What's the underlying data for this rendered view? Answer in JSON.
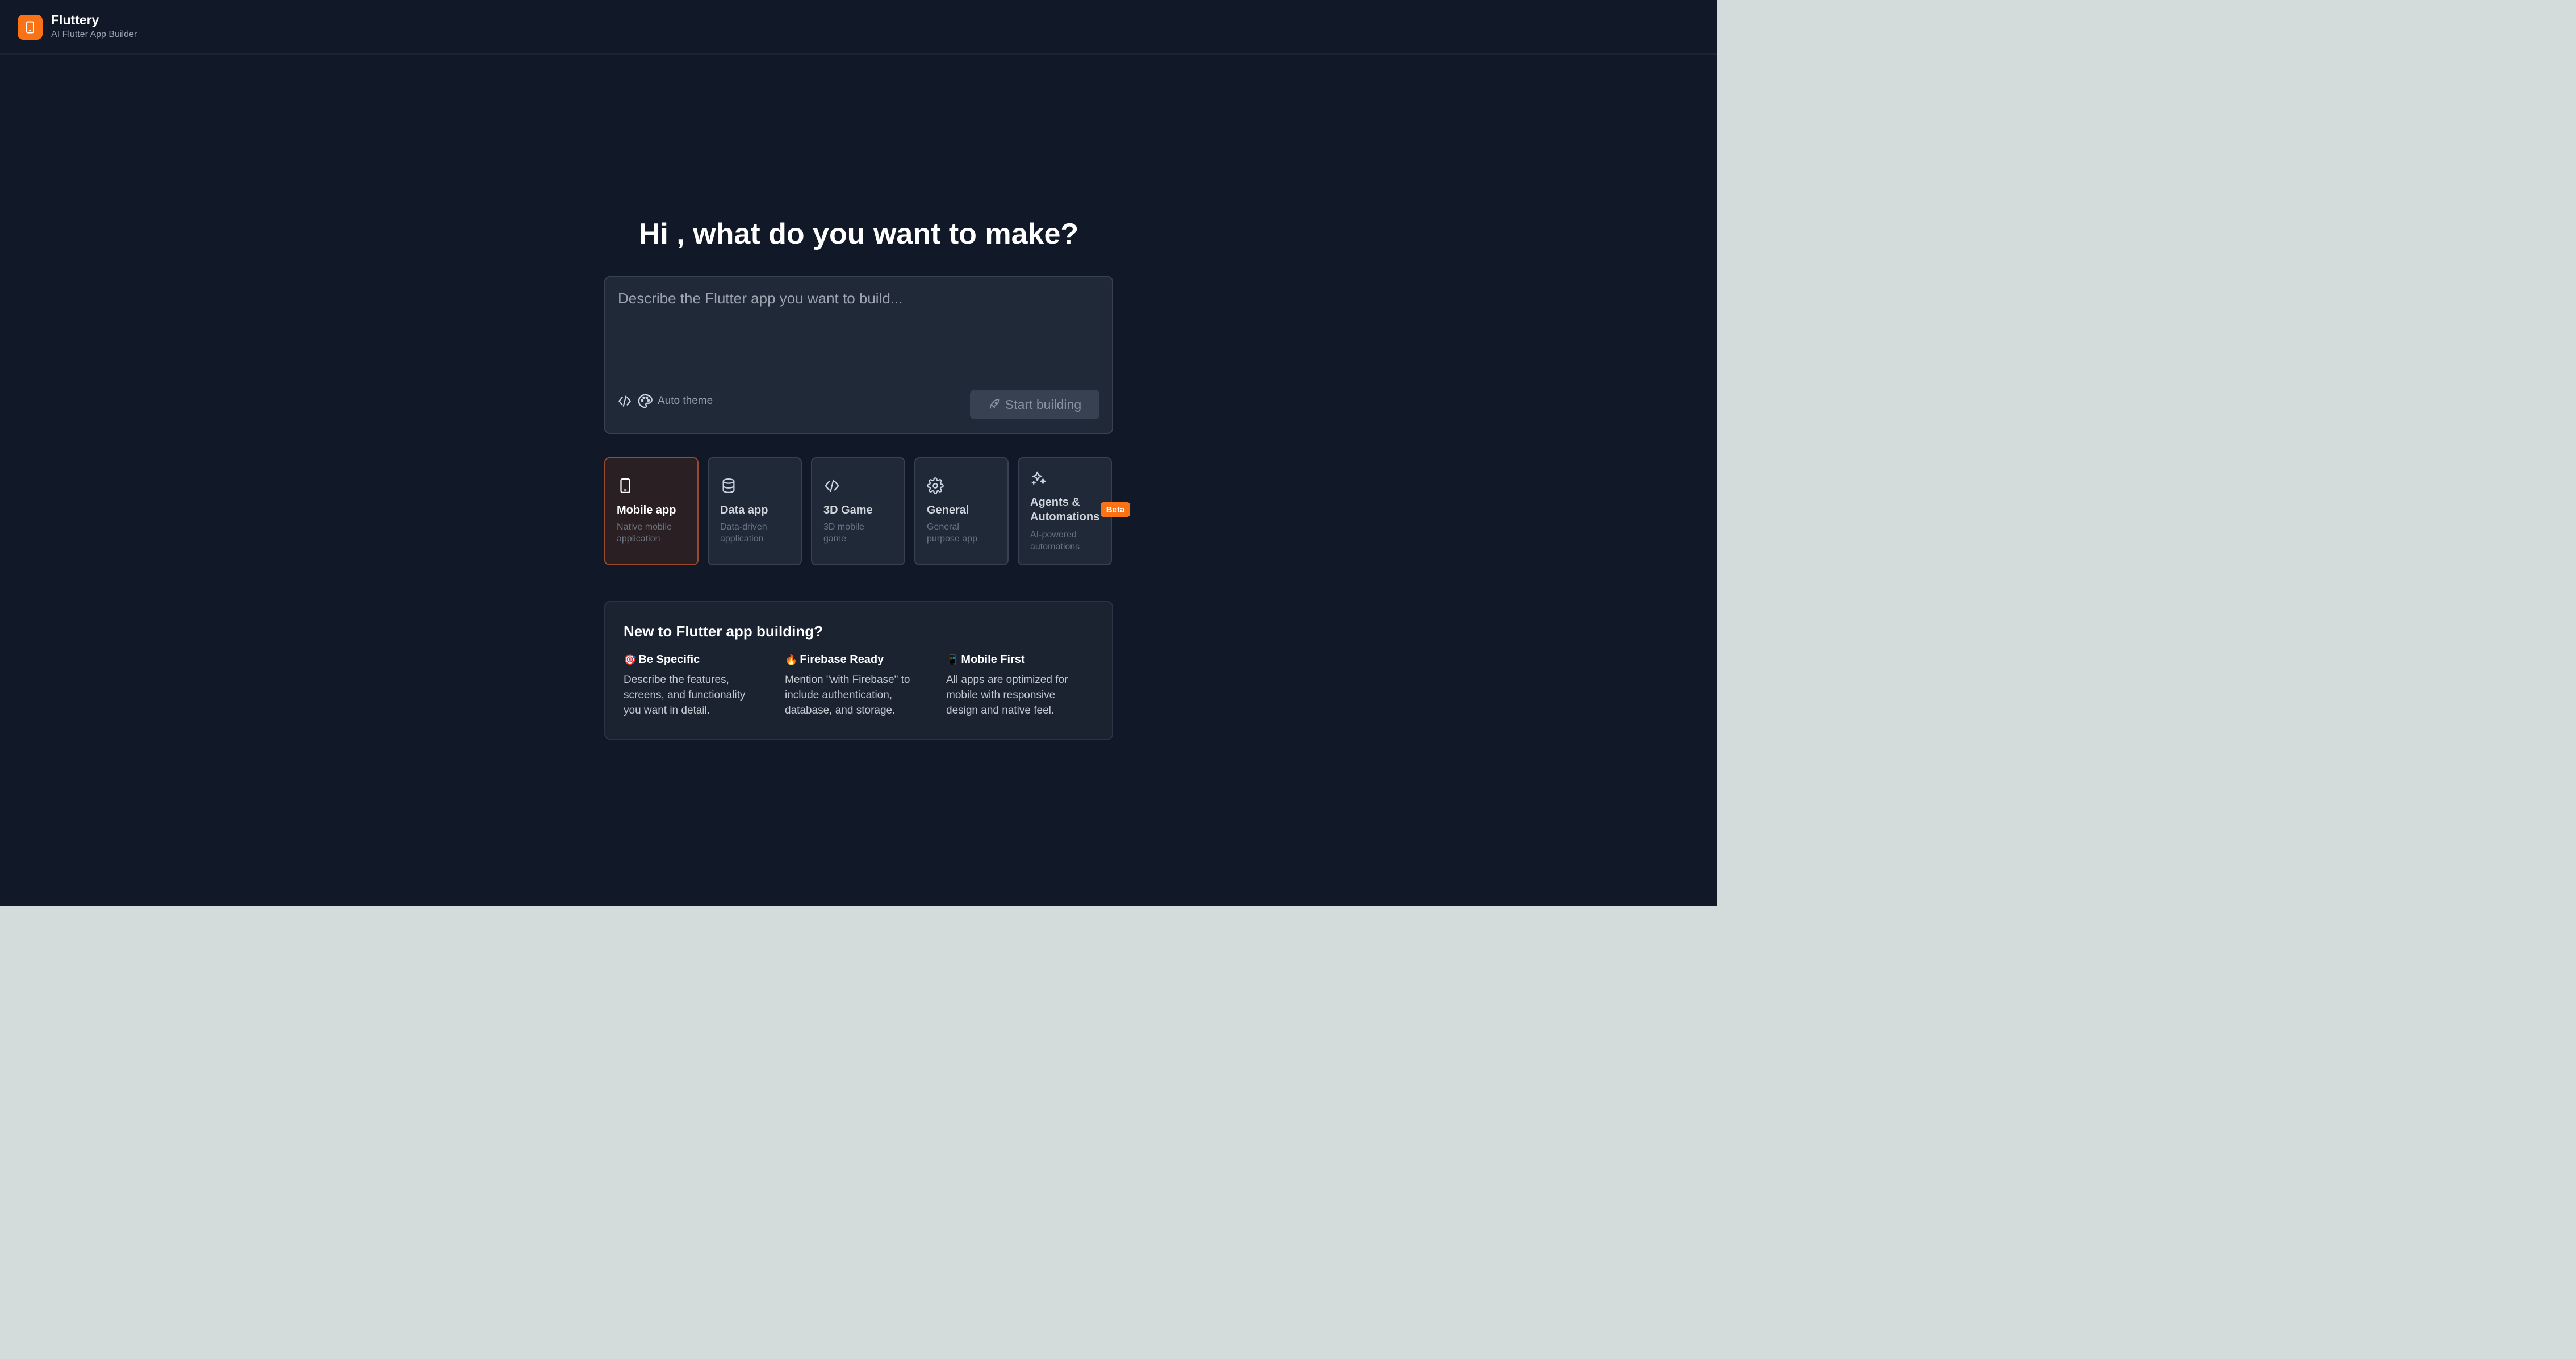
{
  "app": {
    "name": "Fluttery",
    "subtitle": "AI Flutter App Builder",
    "logo_icon": "phone-icon",
    "accent_color": "#f97316",
    "background_color": "#111827"
  },
  "hero": {
    "title": "Hi , what do you want to make?"
  },
  "prompt": {
    "placeholder": "Describe the Flutter app you want to build...",
    "value": "",
    "code_toggle_icon": "code-icon",
    "theme_icon": "palette-icon",
    "theme_label": "Auto theme",
    "start_button_label": "Start building",
    "start_button_icon": "rocket-icon"
  },
  "app_types": [
    {
      "id": "mobile",
      "title": "Mobile app",
      "description": "Native mobile application",
      "icon": "smartphone-icon",
      "selected": true
    },
    {
      "id": "data",
      "title": "Data app",
      "description": "Data-driven application",
      "icon": "database-icon",
      "selected": false
    },
    {
      "id": "game",
      "title": "3D Game",
      "description": "3D mobile game",
      "icon": "code-icon",
      "selected": false
    },
    {
      "id": "general",
      "title": "General",
      "description": "General purpose app",
      "icon": "gear-icon",
      "selected": false
    },
    {
      "id": "agents",
      "title": "Agents & Automations",
      "description": "AI-powered automations",
      "icon": "sparkles-icon",
      "selected": false,
      "badge": "Beta"
    }
  ],
  "tips": {
    "title": "New to Flutter app building?",
    "items": [
      {
        "emoji": "🎯",
        "heading": "Be Specific",
        "text": "Describe the features, screens, and functionality you want in detail."
      },
      {
        "emoji": "🔥",
        "heading": "Firebase Ready",
        "text": "Mention \"with Firebase\" to include authentication, database, and storage."
      },
      {
        "emoji": "📱",
        "heading": "Mobile First",
        "text": "All apps are optimized for mobile with responsive design and native feel."
      }
    ]
  }
}
